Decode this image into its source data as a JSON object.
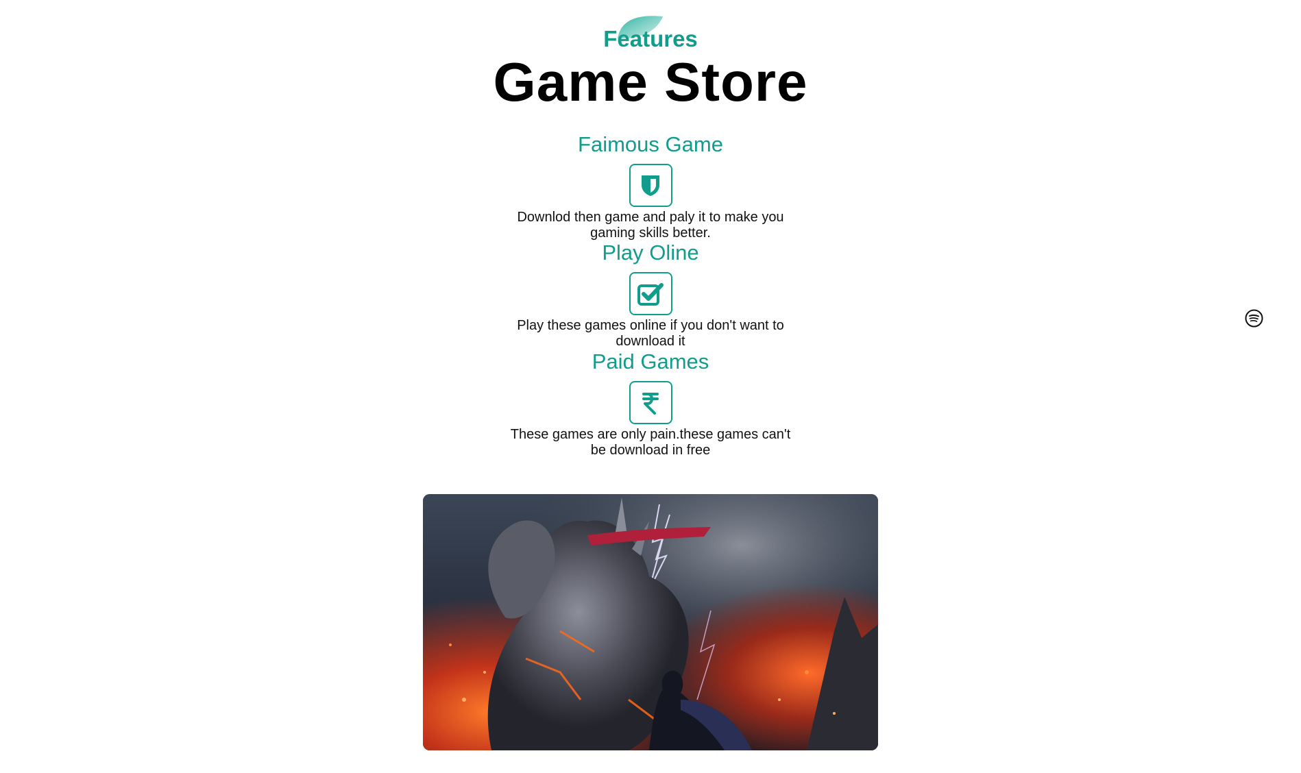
{
  "header": {
    "eyebrow": "Features",
    "title": "Game Store"
  },
  "features": [
    {
      "title": "Faimous Game",
      "icon": "shield-icon",
      "description": "Downlod then game and paly it to make you gaming skills better."
    },
    {
      "title": "Play Oline",
      "icon": "checkbox-icon",
      "description": "Play these games online if you don't want to download it"
    },
    {
      "title": "Paid Games",
      "icon": "rupee-icon",
      "description": "These games are only pain.these games can't be download in free"
    }
  ],
  "banner": {
    "image": "game-artwork"
  },
  "side_widget": {
    "icon": "spotify-icon"
  },
  "colors": {
    "accent": "#119c8c",
    "title": "#000000",
    "text": "#111111"
  }
}
